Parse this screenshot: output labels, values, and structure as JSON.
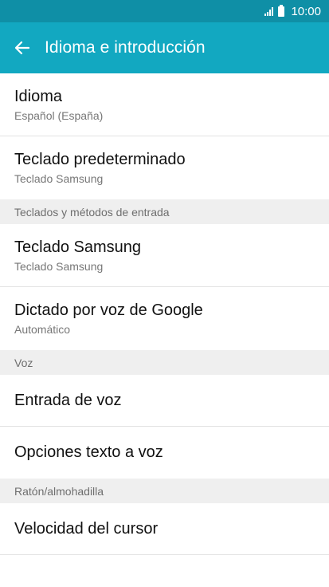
{
  "status_bar": {
    "time": "10:00",
    "icons": [
      "signal-icon",
      "battery-icon"
    ]
  },
  "app_bar": {
    "title": "Idioma e introducción",
    "back_icon": "arrow-left-icon"
  },
  "items": [
    {
      "title": "Idioma",
      "subtitle": "Español (España)"
    },
    {
      "title": "Teclado predeterminado",
      "subtitle": "Teclado Samsung"
    }
  ],
  "sections": [
    {
      "header": "Teclados y métodos de entrada",
      "items": [
        {
          "title": "Teclado Samsung",
          "subtitle": "Teclado Samsung"
        },
        {
          "title": "Dictado por voz de Google",
          "subtitle": "Automático"
        }
      ]
    },
    {
      "header": "Voz",
      "items": [
        {
          "title": "Entrada de voz"
        },
        {
          "title": "Opciones texto a voz"
        }
      ]
    },
    {
      "header": "Ratón/almohadilla",
      "items": [
        {
          "title": "Velocidad del cursor"
        }
      ]
    }
  ],
  "colors": {
    "status_bar": "#0f8fa6",
    "app_bar": "#12a8c1",
    "section_bg": "#efefef"
  }
}
